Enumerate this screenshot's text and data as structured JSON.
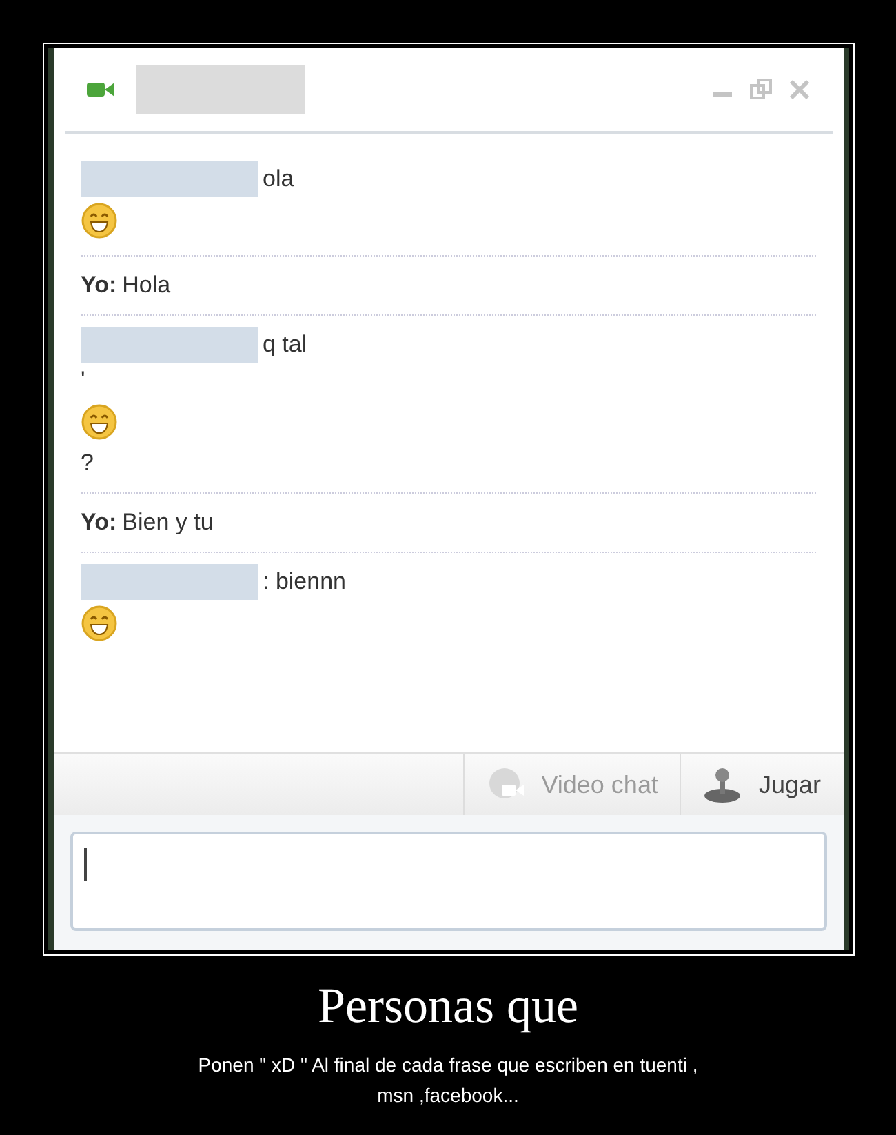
{
  "chat_window": {
    "messages": [
      {
        "kind": "contact",
        "lines": [
          {
            "kind": "text",
            "text": "ola"
          },
          {
            "kind": "emoticon"
          }
        ]
      },
      {
        "kind": "self",
        "sender": "Yo:",
        "lines": [
          {
            "kind": "text",
            "text": "Hola"
          }
        ]
      },
      {
        "kind": "contact",
        "lines": [
          {
            "kind": "text",
            "text": "q tal"
          },
          {
            "kind": "text",
            "text": "'"
          },
          {
            "kind": "emoticon"
          },
          {
            "kind": "text",
            "text": "?"
          }
        ]
      },
      {
        "kind": "self",
        "sender": "Yo:",
        "lines": [
          {
            "kind": "text",
            "text": "Bien y tu"
          }
        ]
      },
      {
        "kind": "contact",
        "lines": [
          {
            "kind": "text",
            "text": ": biennn"
          },
          {
            "kind": "emoticon"
          }
        ]
      }
    ],
    "toolbar": [
      {
        "kind": "video",
        "label": "Video chat",
        "disabled": true
      },
      {
        "kind": "game",
        "label": "Jugar",
        "disabled": false
      }
    ],
    "input": {
      "cursor": true
    }
  },
  "poster": {
    "title": "Personas que",
    "caption": "Ponen \" xD \" Al final de cada frase que escriben en tuenti , msn ,facebook..."
  }
}
